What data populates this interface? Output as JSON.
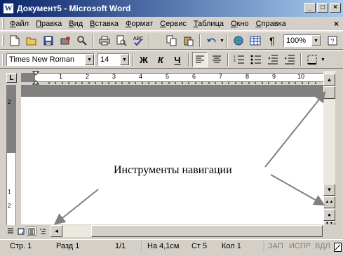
{
  "window": {
    "title": "Документ5 - Microsoft Word",
    "icon_letter": "W",
    "buttons": {
      "minimize": "_",
      "maximize": "□",
      "close": "×"
    }
  },
  "menu": {
    "items": [
      "Файл",
      "Правка",
      "Вид",
      "Вставка",
      "Формат",
      "Сервис",
      "Таблица",
      "Окно",
      "Справка"
    ],
    "close_doc": "×"
  },
  "standard_toolbar": {
    "zoom": "100%",
    "icons": [
      "new-icon",
      "open-icon",
      "save-icon",
      "permission-icon",
      "search-icon",
      "print-icon",
      "print-preview-icon",
      "spelling-icon",
      "cut-icon",
      "copy-icon",
      "paste-icon",
      "undo-icon",
      "hyperlink-icon",
      "table-icon",
      "show-formatting-icon",
      "help-icon"
    ]
  },
  "formatting_toolbar": {
    "font": "Times New Roman",
    "size": "14",
    "bold": "Ж",
    "italic": "К",
    "underline": "Ч",
    "icons": [
      "align-left-icon",
      "center-icon",
      "numbering-icon",
      "bullets-icon",
      "decrease-indent-icon",
      "increase-indent-icon",
      "borders-icon"
    ]
  },
  "ruler": {
    "corner": "L",
    "h_numbers": [
      "1",
      "2",
      "3",
      "4",
      "5",
      "6",
      "7",
      "8",
      "9",
      "10"
    ],
    "v_numbers": [
      "2",
      "1",
      "1",
      "2"
    ]
  },
  "scrollbar": {
    "up": "▲",
    "down": "▼",
    "left": "◄",
    "right": "►",
    "prev_page": "▲▲",
    "select_object": "●",
    "next_page": "▼▼"
  },
  "statusbar": {
    "page": "Стр.  1",
    "section": "Разд  1",
    "pages": "1/1",
    "at": "На 4,1см",
    "line": "Ст  5",
    "col": "Кол  1",
    "rec": "ЗАП",
    "trk": "ИСПР",
    "ext": "ВДЛ"
  },
  "annotation": {
    "text": "Инструменты навигации"
  }
}
